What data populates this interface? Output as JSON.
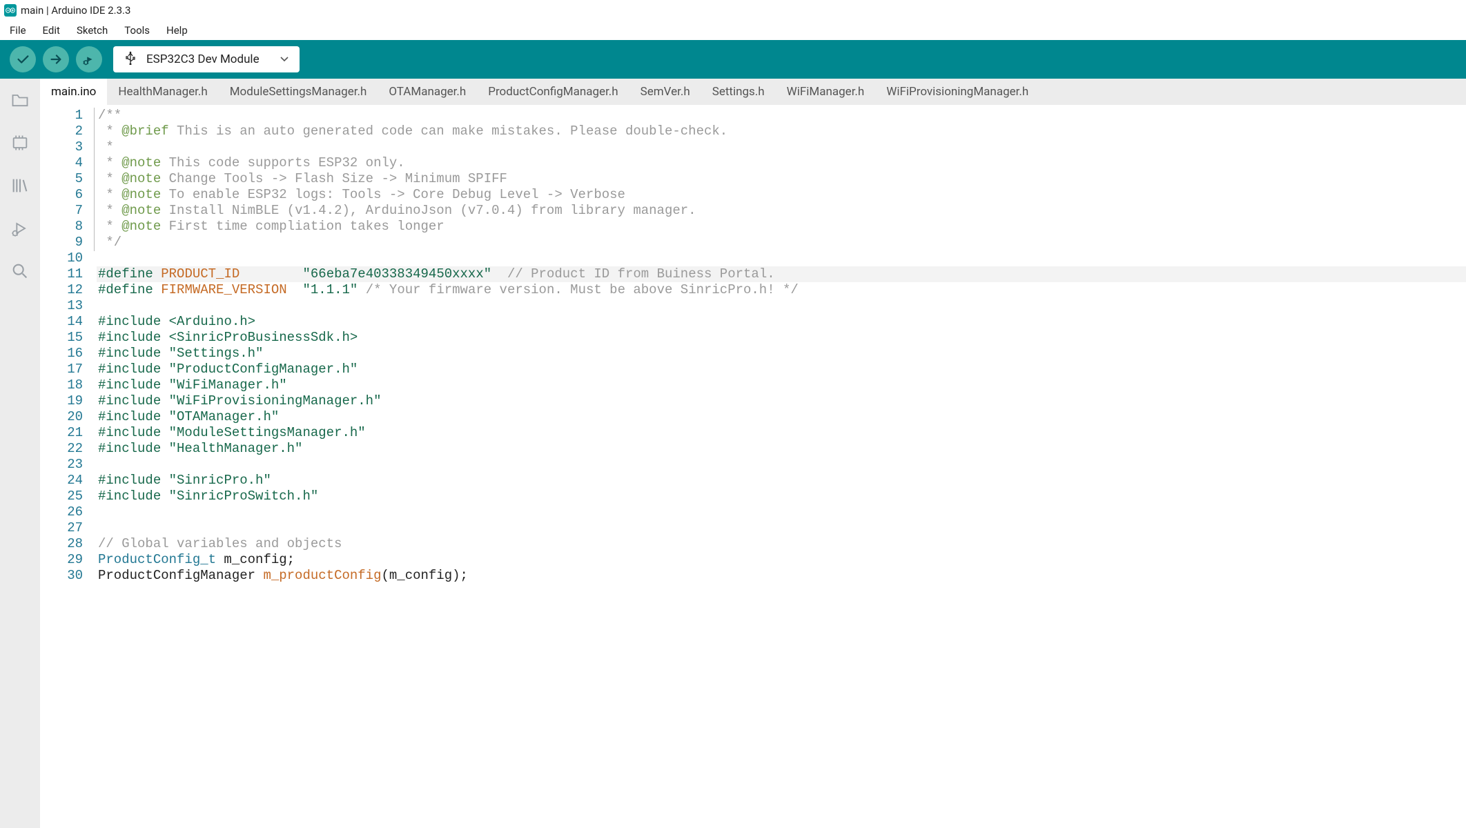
{
  "window": {
    "title": "main | Arduino IDE 2.3.3"
  },
  "menu": [
    "File",
    "Edit",
    "Sketch",
    "Tools",
    "Help"
  ],
  "toolbar": {
    "verify": "Verify",
    "upload": "Upload",
    "debug": "Debug",
    "board": "ESP32C3 Dev Module"
  },
  "sidebar_tools": [
    "folder",
    "board-manager",
    "library-manager",
    "debug",
    "search"
  ],
  "tabs": [
    "main.ino",
    "HealthManager.h",
    "ModuleSettingsManager.h",
    "OTAManager.h",
    "ProductConfigManager.h",
    "SemVer.h",
    "Settings.h",
    "WiFiManager.h",
    "WiFiProvisioningManager.h"
  ],
  "active_tab": 0,
  "active_line": 11,
  "colors": {
    "teal": "#00878f",
    "accent": "#4db6ac"
  },
  "code": {
    "lines": [
      {
        "n": 1,
        "t": [
          [
            "comment",
            "/**"
          ]
        ]
      },
      {
        "n": 2,
        "t": [
          [
            "comment",
            " * "
          ],
          [
            "doctag",
            "@brief"
          ],
          [
            "comment",
            " This is an auto generated code can make mistakes. Please double-check."
          ]
        ]
      },
      {
        "n": 3,
        "t": [
          [
            "comment",
            " *"
          ]
        ]
      },
      {
        "n": 4,
        "t": [
          [
            "comment",
            " * "
          ],
          [
            "doctag",
            "@note"
          ],
          [
            "comment",
            " This code supports ESP32 only."
          ]
        ]
      },
      {
        "n": 5,
        "t": [
          [
            "comment",
            " * "
          ],
          [
            "doctag",
            "@note"
          ],
          [
            "comment",
            " Change Tools -> Flash Size -> Minimum SPIFF"
          ]
        ]
      },
      {
        "n": 6,
        "t": [
          [
            "comment",
            " * "
          ],
          [
            "doctag",
            "@note"
          ],
          [
            "comment",
            " To enable ESP32 logs: Tools -> Core Debug Level -> Verbose"
          ]
        ]
      },
      {
        "n": 7,
        "t": [
          [
            "comment",
            " * "
          ],
          [
            "doctag",
            "@note"
          ],
          [
            "comment",
            " Install NimBLE (v1.4.2), ArduinoJson (v7.0.4) from library manager."
          ]
        ]
      },
      {
        "n": 8,
        "t": [
          [
            "comment",
            " * "
          ],
          [
            "doctag",
            "@note"
          ],
          [
            "comment",
            " First time compliation takes longer"
          ]
        ]
      },
      {
        "n": 9,
        "t": [
          [
            "comment",
            " */"
          ]
        ]
      },
      {
        "n": 10,
        "t": [
          [
            "plain",
            ""
          ]
        ]
      },
      {
        "n": 11,
        "t": [
          [
            "pp",
            "#define"
          ],
          [
            "plain",
            " "
          ],
          [
            "macro",
            "PRODUCT_ID"
          ],
          [
            "plain",
            "        "
          ],
          [
            "string",
            "\"66eba7e40338349450xxxx\""
          ],
          [
            "plain",
            "  "
          ],
          [
            "comment",
            "// Product ID from Buiness Portal."
          ]
        ]
      },
      {
        "n": 12,
        "t": [
          [
            "pp",
            "#define"
          ],
          [
            "plain",
            " "
          ],
          [
            "macro",
            "FIRMWARE_VERSION"
          ],
          [
            "plain",
            "  "
          ],
          [
            "string",
            "\"1.1.1\""
          ],
          [
            "plain",
            " "
          ],
          [
            "comment",
            "/* Your firmware version. Must be above SinricPro.h! */"
          ]
        ]
      },
      {
        "n": 13,
        "t": [
          [
            "plain",
            ""
          ]
        ]
      },
      {
        "n": 14,
        "t": [
          [
            "pp",
            "#include"
          ],
          [
            "plain",
            " "
          ],
          [
            "string",
            "<Arduino.h>"
          ]
        ]
      },
      {
        "n": 15,
        "t": [
          [
            "pp",
            "#include"
          ],
          [
            "plain",
            " "
          ],
          [
            "string",
            "<SinricProBusinessSdk.h>"
          ]
        ]
      },
      {
        "n": 16,
        "t": [
          [
            "pp",
            "#include"
          ],
          [
            "plain",
            " "
          ],
          [
            "string",
            "\"Settings.h\""
          ]
        ]
      },
      {
        "n": 17,
        "t": [
          [
            "pp",
            "#include"
          ],
          [
            "plain",
            " "
          ],
          [
            "string",
            "\"ProductConfigManager.h\""
          ]
        ]
      },
      {
        "n": 18,
        "t": [
          [
            "pp",
            "#include"
          ],
          [
            "plain",
            " "
          ],
          [
            "string",
            "\"WiFiManager.h\""
          ]
        ]
      },
      {
        "n": 19,
        "t": [
          [
            "pp",
            "#include"
          ],
          [
            "plain",
            " "
          ],
          [
            "string",
            "\"WiFiProvisioningManager.h\""
          ]
        ]
      },
      {
        "n": 20,
        "t": [
          [
            "pp",
            "#include"
          ],
          [
            "plain",
            " "
          ],
          [
            "string",
            "\"OTAManager.h\""
          ]
        ]
      },
      {
        "n": 21,
        "t": [
          [
            "pp",
            "#include"
          ],
          [
            "plain",
            " "
          ],
          [
            "string",
            "\"ModuleSettingsManager.h\""
          ]
        ]
      },
      {
        "n": 22,
        "t": [
          [
            "pp",
            "#include"
          ],
          [
            "plain",
            " "
          ],
          [
            "string",
            "\"HealthManager.h\""
          ]
        ]
      },
      {
        "n": 23,
        "t": [
          [
            "plain",
            ""
          ]
        ]
      },
      {
        "n": 24,
        "t": [
          [
            "pp",
            "#include"
          ],
          [
            "plain",
            " "
          ],
          [
            "string",
            "\"SinricPro.h\""
          ]
        ]
      },
      {
        "n": 25,
        "t": [
          [
            "pp",
            "#include"
          ],
          [
            "plain",
            " "
          ],
          [
            "string",
            "\"SinricProSwitch.h\""
          ]
        ]
      },
      {
        "n": 26,
        "t": [
          [
            "plain",
            ""
          ]
        ]
      },
      {
        "n": 27,
        "t": [
          [
            "plain",
            ""
          ]
        ]
      },
      {
        "n": 28,
        "t": [
          [
            "comment",
            "// Global variables and objects"
          ]
        ]
      },
      {
        "n": 29,
        "t": [
          [
            "type",
            "ProductConfig_t"
          ],
          [
            "plain",
            " m_config;"
          ]
        ]
      },
      {
        "n": 30,
        "t": [
          [
            "plain",
            "ProductConfigManager "
          ],
          [
            "member",
            "m_productConfig"
          ],
          [
            "plain",
            "(m_config);"
          ]
        ]
      }
    ]
  }
}
